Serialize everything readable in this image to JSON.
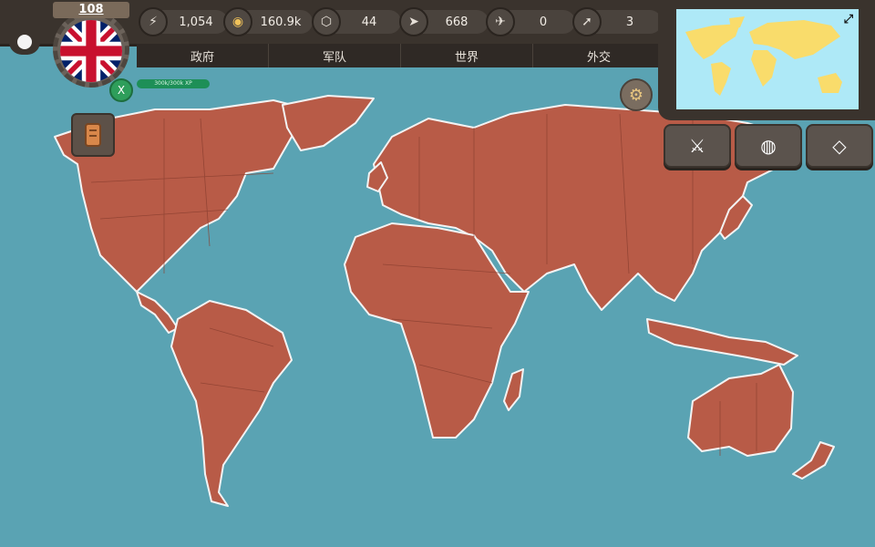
{
  "player": {
    "level": "108",
    "xp_text": "300k/300k XP",
    "x_label": "X"
  },
  "resources": [
    {
      "icon": "lightning-icon",
      "glyph": "⚡",
      "value": "1,054"
    },
    {
      "icon": "gold-icon",
      "glyph": "◉",
      "value": "160.9k"
    },
    {
      "icon": "manpower-icon",
      "glyph": "⬡",
      "value": "44"
    },
    {
      "icon": "tank-icon",
      "glyph": "➤",
      "value": "668"
    },
    {
      "icon": "plane-icon",
      "glyph": "✈",
      "value": "0"
    },
    {
      "icon": "missile-icon",
      "glyph": "➚",
      "value": "3"
    }
  ],
  "tabs": [
    "政府",
    "军队",
    "世界",
    "外交"
  ],
  "actions": [
    {
      "name": "sword-icon",
      "glyph": "⚔"
    },
    {
      "name": "globe-icon",
      "glyph": "◍"
    },
    {
      "name": "diamond-icon",
      "glyph": "◇"
    }
  ],
  "colors": {
    "ocean": "#5aa3b3",
    "land": "#b85b47",
    "minimap_land": "#f9dc6b",
    "minimap_ocean": "#aee9f7"
  }
}
